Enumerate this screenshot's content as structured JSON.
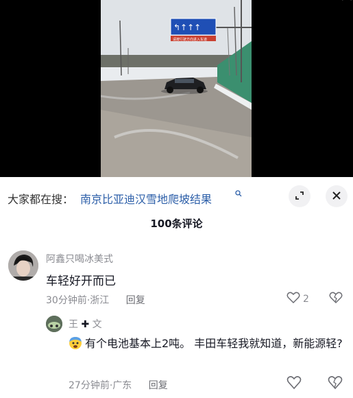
{
  "video": {
    "sign_caption": "请按行驶方向进入车道"
  },
  "search": {
    "prefix": "大家都在搜：",
    "term": "南京比亚迪汉雪地爬坡结果"
  },
  "comments_header": {
    "count_label": "100条评论"
  },
  "comments": [
    {
      "username": "阿鑫只喝冰美式",
      "text": "车轻好开而已",
      "time": "30分钟前",
      "location": "浙江",
      "reply_label": "回复",
      "likes": "2"
    }
  ],
  "reply": {
    "username": "王",
    "username_suffix": "文",
    "text": "有个电池基本上2吨。 丰田车轻我就知道，新能源轻?",
    "time": "27分钟前",
    "location": "广东",
    "reply_label": "回复"
  },
  "colors": {
    "link": "#2b5ea8",
    "muted": "#8a8b91"
  }
}
